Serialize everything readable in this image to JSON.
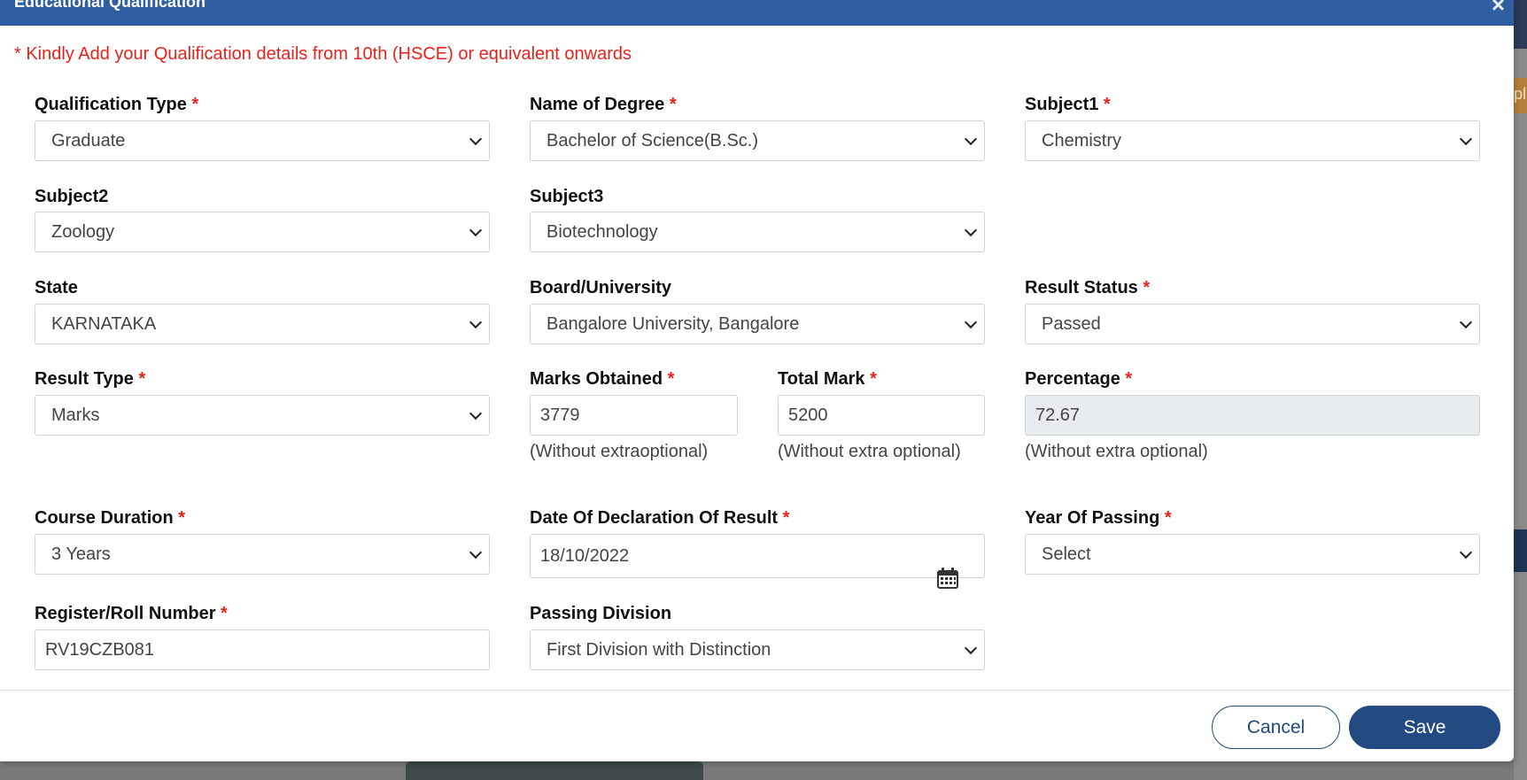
{
  "modal": {
    "title": "Educational Qualification",
    "close_glyph": "×",
    "notice": "* Kindly Add your Qualification details from 10th (HSCE) or equivalent onwards"
  },
  "background": {
    "side_letter": "pl"
  },
  "required_mark": "*",
  "fields": {
    "qualification_type": {
      "label": "Qualification Type",
      "value": "Graduate"
    },
    "name_of_degree": {
      "label": "Name of Degree",
      "value": "Bachelor of Science(B.Sc.)"
    },
    "subject1": {
      "label": "Subject1",
      "value": "Chemistry"
    },
    "subject2": {
      "label": "Subject2",
      "value": "Zoology"
    },
    "subject3": {
      "label": "Subject3",
      "value": "Biotechnology"
    },
    "state": {
      "label": "State",
      "value": "KARNATAKA"
    },
    "board_university": {
      "label": "Board/University",
      "value": "Bangalore University, Bangalore"
    },
    "result_status": {
      "label": "Result Status",
      "value": "Passed"
    },
    "result_type": {
      "label": "Result Type",
      "value": "Marks"
    },
    "marks_obtained": {
      "label": "Marks Obtained",
      "value": "3779",
      "hint": "(Without extraoptional)"
    },
    "total_mark": {
      "label": "Total Mark",
      "value": "5200",
      "hint": "(Without extra optional)"
    },
    "percentage": {
      "label": "Percentage",
      "value": "72.67",
      "hint": "(Without extra optional)"
    },
    "course_duration": {
      "label": "Course Duration",
      "value": "3 Years"
    },
    "date_of_declaration": {
      "label": "Date Of Declaration Of Result",
      "value": "18/10/2022"
    },
    "year_of_passing": {
      "label": "Year Of Passing",
      "value": "Select"
    },
    "register_roll_number": {
      "label": "Register/Roll Number",
      "value": "RV19CZB081"
    },
    "passing_division": {
      "label": "Passing Division",
      "value": "First Division with Distinction"
    }
  },
  "buttons": {
    "cancel": "Cancel",
    "save": "Save"
  },
  "colors": {
    "header": "#2f5fa0",
    "required": "#e8221b",
    "primary_button": "#234a82"
  }
}
